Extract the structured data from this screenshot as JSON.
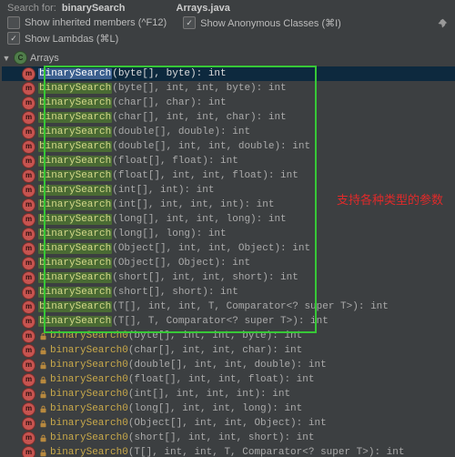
{
  "header": {
    "search_label": "Search for:",
    "search_term": "binarySearch",
    "file_name": "Arrays.java"
  },
  "options": {
    "inherited": {
      "checked": false,
      "label": "Show inherited members (^F12)"
    },
    "anonymous": {
      "checked": true,
      "label": "Show Anonymous Classes (⌘I)"
    },
    "lambdas": {
      "checked": true,
      "label": "Show Lambdas (⌘L)"
    }
  },
  "tree": {
    "class_name": "Arrays"
  },
  "method_name": "binarySearch",
  "method_name0": "binarySearch0",
  "methods_highlighted": [
    "(byte[], byte): int",
    "(byte[], int, int, byte): int",
    "(char[], char): int",
    "(char[], int, int, char): int",
    "(double[], double): int",
    "(double[], int, int, double): int",
    "(float[], float): int",
    "(float[], int, int, float): int",
    "(int[], int): int",
    "(int[], int, int, int): int",
    "(long[], int, int, long): int",
    "(long[], long): int",
    "(Object[], int, int, Object): int",
    "(Object[], Object): int",
    "(short[], int, int, short): int",
    "(short[], short): int",
    "(T[], int, int, T, Comparator<? super T>): int",
    "(T[], T, Comparator<? super T>): int"
  ],
  "methods_private": [
    "(byte[], int, int, byte): int",
    "(char[], int, int, char): int",
    "(double[], int, int, double): int",
    "(float[], int, int, float): int",
    "(int[], int, int, int): int",
    "(long[], int, int, long): int",
    "(Object[], int, int, Object): int",
    "(short[], int, int, short): int",
    "(T[], int, int, T, Comparator<? super T>): int"
  ],
  "annotation": "支持各种类型的参数"
}
